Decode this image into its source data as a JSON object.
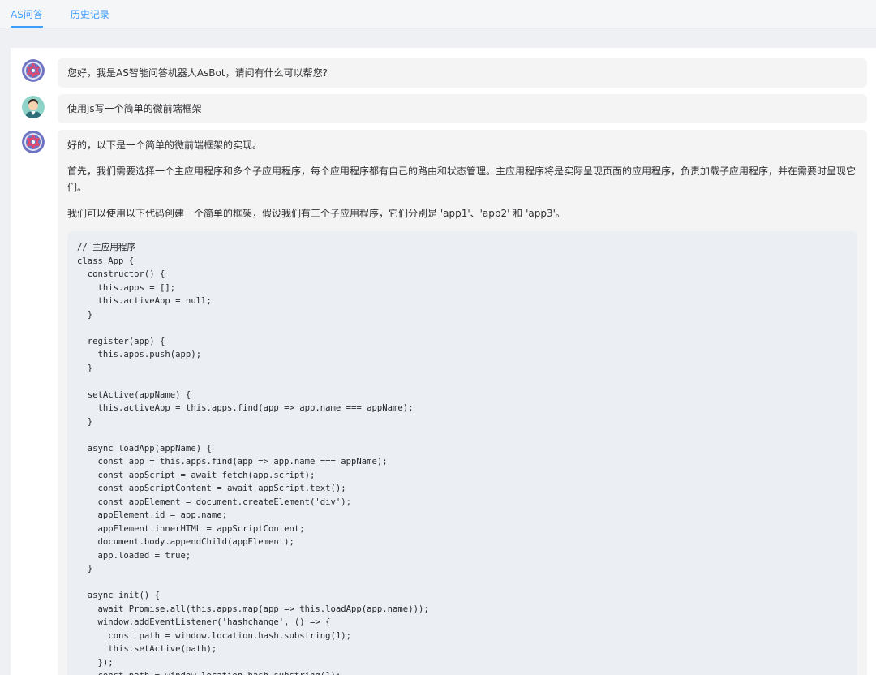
{
  "tabs": [
    {
      "label": "AS问答"
    },
    {
      "label": "历史记录"
    }
  ],
  "messages": {
    "m1": {
      "text": "您好，我是AS智能问答机器人AsBot，请问有什么可以帮您?"
    },
    "m2": {
      "text": "使用js写一个简单的微前端框架"
    },
    "m3": {
      "p1": "好的，以下是一个简单的微前端框架的实现。",
      "p2": "首先，我们需要选择一个主应用程序和多个子应用程序，每个应用程序都有自己的路由和状态管理。主应用程序将是实际呈现页面的应用程序，负责加载子应用程序，并在需要时呈现它们。",
      "p3": "我们可以使用以下代码创建一个简单的框架，假设我们有三个子应用程序，它们分别是 'app1'、'app2' 和 'app3'。",
      "code": "// 主应用程序\nclass App {\n  constructor() {\n    this.apps = [];\n    this.activeApp = null;\n  }\n\n  register(app) {\n    this.apps.push(app);\n  }\n\n  setActive(appName) {\n    this.activeApp = this.apps.find(app => app.name === appName);\n  }\n\n  async loadApp(appName) {\n    const app = this.apps.find(app => app.name === appName);\n    const appScript = await fetch(app.script);\n    const appScriptContent = await appScript.text();\n    const appElement = document.createElement('div');\n    appElement.id = app.name;\n    appElement.innerHTML = appScriptContent;\n    document.body.appendChild(appElement);\n    app.loaded = true;\n  }\n\n  async init() {\n    await Promise.all(this.apps.map(app => this.loadApp(app.name)));\n    window.addEventListener('hashchange', () => {\n      const path = window.location.hash.substring(1);\n      this.setActive(path);\n    });\n    const path = window.location.hash.substring(1);"
    }
  },
  "icons": {
    "bot_avatar": "bot-avatar-icon",
    "user_avatar": "user-avatar-icon"
  },
  "colors": {
    "accent": "#409eff",
    "bubble": "#f4f4f5",
    "code_bg": "#ebeef2"
  }
}
